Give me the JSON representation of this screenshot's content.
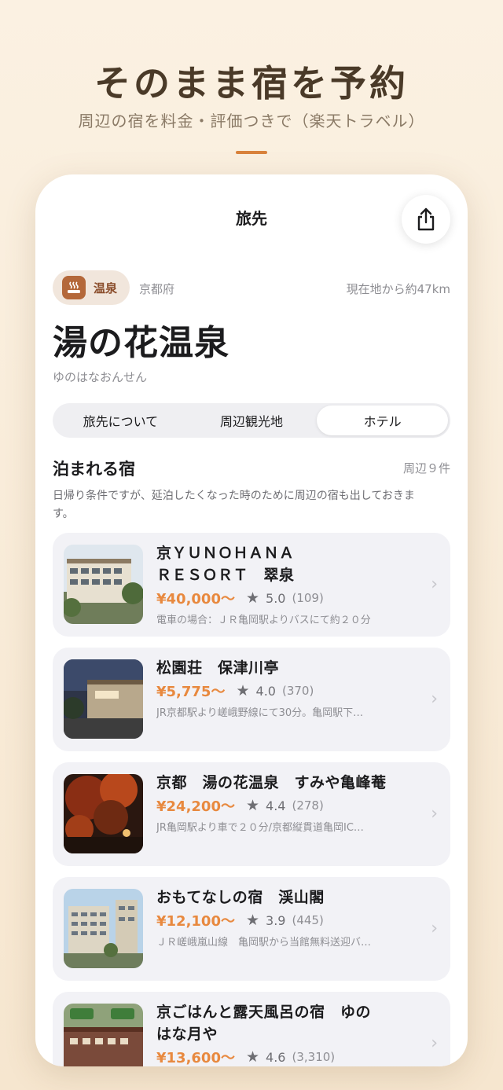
{
  "hero": {
    "title": "そのまま宿を予約",
    "subtitle": "周辺の宿を料金・評価つきで（楽天トラベル）",
    "accent_color": "#d9823c"
  },
  "screen": {
    "nav_title": "旅先",
    "share_icon": "share-icon",
    "tag": {
      "icon": "onsen-icon",
      "label": "温泉"
    },
    "prefecture": "京都府",
    "distance": "現在地から約47km",
    "destination_name": "湯の花温泉",
    "destination_reading": "ゆのはなおんせん",
    "tabs": [
      {
        "label": "旅先について",
        "active": false
      },
      {
        "label": "周辺観光地",
        "active": false
      },
      {
        "label": "ホテル",
        "active": true
      }
    ],
    "section": {
      "title": "泊まれる宿",
      "count": "周辺９件",
      "note": "日帰り条件ですが、延泊したくなった時のために周辺の宿も出しておきます。"
    },
    "hotels": [
      {
        "name": "京ＹＵＮＯＨＡＮＡ\nＲＥＳＯＲＴ　翠泉",
        "price": "¥40,000～",
        "rating": "5.0",
        "reviews": "(109)",
        "access": "電車の場合：ＪＲ亀岡駅よりバスにて約２０分"
      },
      {
        "name": "松園荘　保津川亭",
        "price": "¥5,775～",
        "rating": "4.0",
        "reviews": "(370)",
        "access": "JR京都駅より嵯峨野線にて30分。亀岡駅下…"
      },
      {
        "name": "京都　湯の花温泉　すみや亀峰菴",
        "price": "¥24,200～",
        "rating": "4.4",
        "reviews": "(278)",
        "access": "JR亀岡駅より車で２０分/京都縦貫道亀岡IC…"
      },
      {
        "name": "おもてなしの宿　渓山閣",
        "price": "¥12,100～",
        "rating": "3.9",
        "reviews": "(445)",
        "access": "ＪＲ嵯峨嵐山線　亀岡駅から当館無料送迎バ…"
      },
      {
        "name": "京ごはんと露天風呂の宿　ゆの\nはな月や",
        "price": "¥13,600～",
        "rating": "4.6",
        "reviews": "(3,310)",
        "access": ""
      }
    ]
  },
  "colors": {
    "price": "#e8893f",
    "tag_bg": "#f1e6dc",
    "card_bg": "#f2f2f6"
  }
}
